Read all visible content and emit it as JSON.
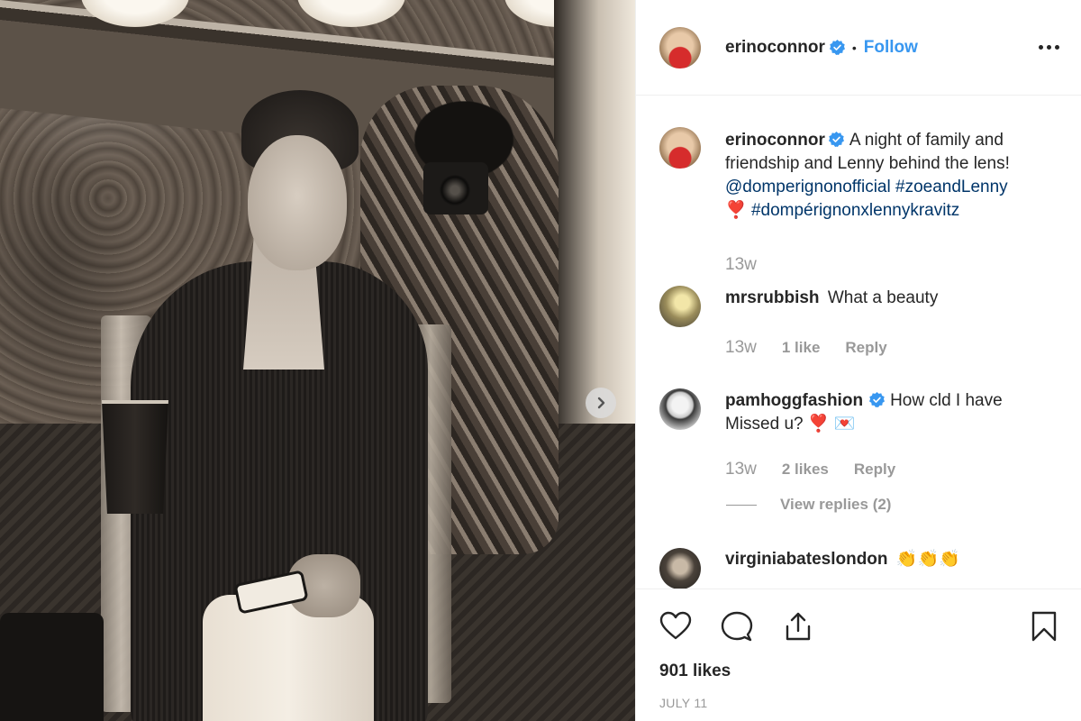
{
  "post": {
    "author": "erinoconnor",
    "follow_label": "Follow",
    "dot": "•",
    "caption": {
      "text": "A night of family and friendship and Lenny behind the lens!",
      "mention": "@domperignonofficial",
      "hashtag1": "#zoeandLenny",
      "emoji": "❣️",
      "hashtag2": "#dompérignonxlennykravitz",
      "time": "13w"
    },
    "likes": "901 likes",
    "date": "JULY 11"
  },
  "comments": [
    {
      "user": "mrsrubbish",
      "text": "What a beauty",
      "time": "13w",
      "likes": "1 like",
      "reply": "Reply"
    },
    {
      "user": "pamhoggfashion",
      "text": "How cld I have Missed u? ❣️ 💌",
      "time": "13w",
      "likes": "2 likes",
      "reply": "Reply",
      "view_replies": "View replies (2)"
    },
    {
      "user": "virginiabateslondon",
      "text": "👏👏👏"
    }
  ],
  "icons": {
    "like": "heart-icon",
    "comment": "comment-icon",
    "share": "share-icon",
    "save": "bookmark-icon",
    "next": "chevron-right-icon"
  },
  "colors": {
    "link": "#003569",
    "follow": "#3897f0",
    "verified": "#3897f0",
    "muted": "#999999"
  }
}
